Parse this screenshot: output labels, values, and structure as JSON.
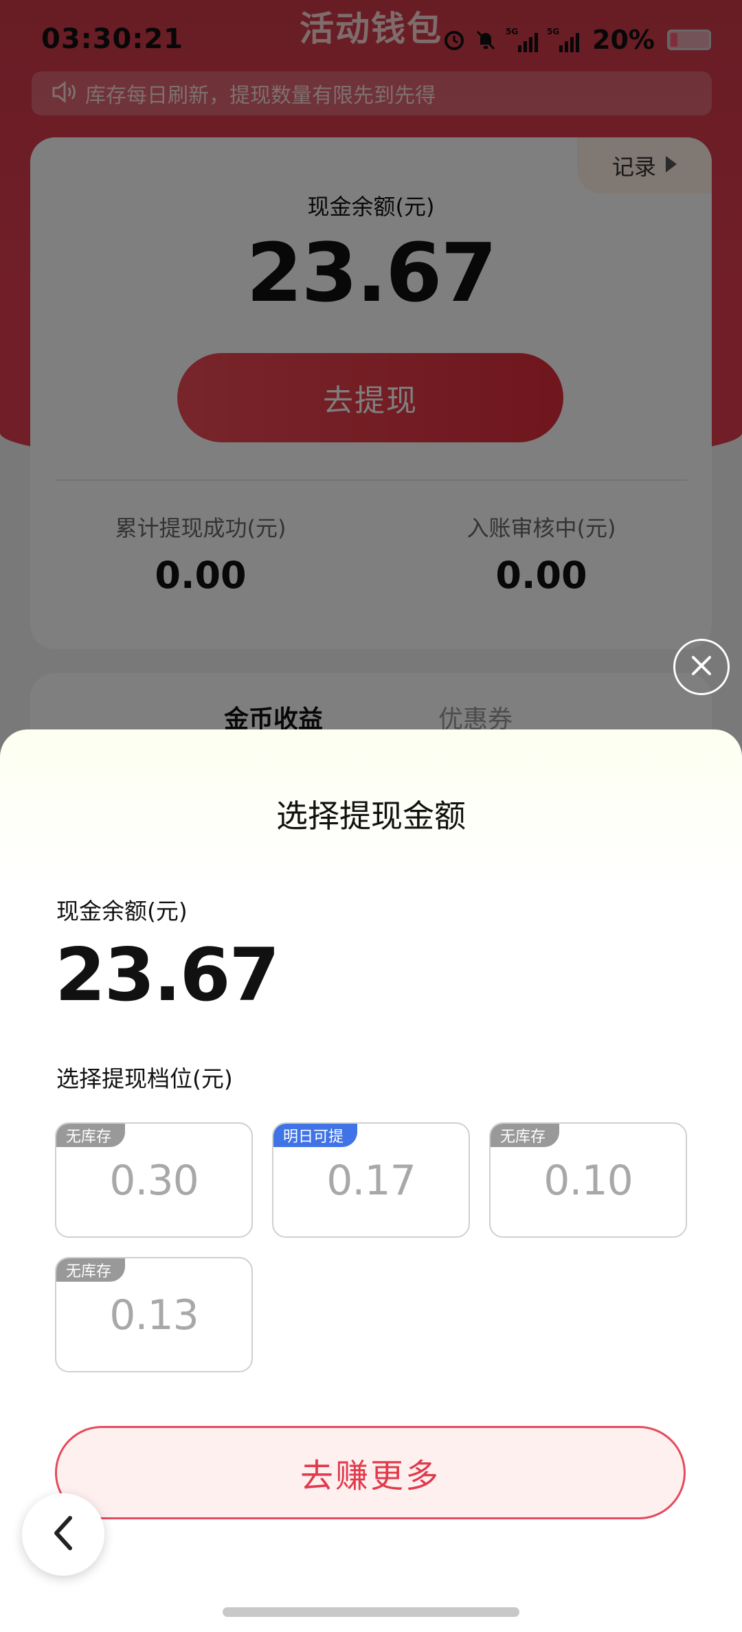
{
  "status_bar": {
    "time": "03:30:21",
    "network_1": "5G",
    "network_2": "5G",
    "battery_percent": "20%"
  },
  "page": {
    "title": "活动钱包",
    "notice": "库存每日刷新，提现数量有限先到先得",
    "notice_icon": "speaker-icon"
  },
  "wallet": {
    "record_label": "记录",
    "cash_label": "现金余额(元)",
    "cash_value": "23.67",
    "withdraw_label": "去提现",
    "total_withdrawn_label": "累计提现成功(元)",
    "total_withdrawn_value": "0.00",
    "pending_label": "入账审核中(元)",
    "pending_value": "0.00"
  },
  "tabs": [
    {
      "label": "金币收益",
      "active": true
    },
    {
      "label": "优惠券",
      "active": false
    }
  ],
  "sheet": {
    "title": "选择提现金额",
    "balance_label": "现金余额(元)",
    "balance_value": "23.67",
    "tier_label": "选择提现档位(元)",
    "tiers": [
      {
        "badge": "无库存",
        "value": "0.30",
        "badge_color": "#999999"
      },
      {
        "badge": "明日可提",
        "value": "0.17",
        "badge_color": "#3f73e6"
      },
      {
        "badge": "无库存",
        "value": "0.10",
        "badge_color": "#999999"
      },
      {
        "badge": "无库存",
        "value": "0.13",
        "badge_color": "#999999"
      }
    ],
    "earn_more_label": "去赚更多"
  },
  "colors": {
    "brand_red": "#e23c50",
    "badge_blue": "#3f73e6",
    "badge_gray": "#999999"
  }
}
